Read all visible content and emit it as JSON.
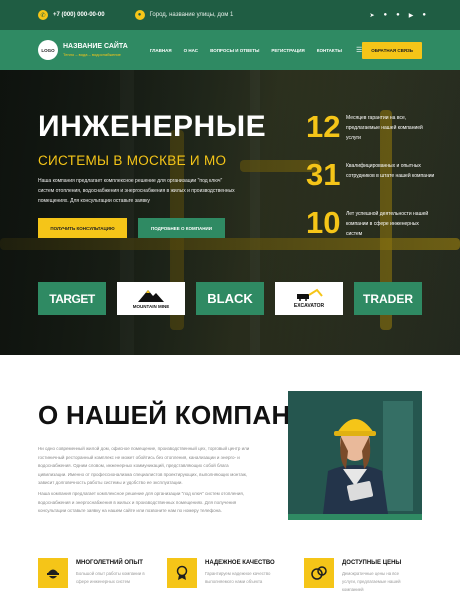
{
  "topbar": {
    "phone": "+7 (000) 000-00-00",
    "address": "Город, название улицы, дом 1",
    "phone_icon": "phone-icon",
    "address_icon": "location-pin-icon",
    "socials": [
      "telegram-icon",
      "vk-icon",
      "twitter-icon",
      "youtube-icon",
      "whatsapp-icon"
    ]
  },
  "header": {
    "logo": "LOGO",
    "brand_name": "НАЗВАНИЕ САЙТА",
    "tagline": "Тепло – вода – водоснабжение",
    "menu": [
      "ГЛАВНАЯ",
      "О НАС",
      "ВОПРОСЫ И ОТВЕТЫ",
      "РЕГИСТРАЦИЯ",
      "КОНТАКТЫ"
    ],
    "cta": "ОБРАТНАЯ СВЯЗЬ"
  },
  "hero": {
    "title": "ИНЖЕНЕРНЫЕ",
    "subtitle": "СИСТЕМЫ В МОСКВЕ И МО",
    "description": "Наша компания предлагает комплексное решение для организации \"под ключ\" систем отопления, водоснабжения и энергоснабжения в жилых и производственных помещениях. Для консультации оставьте заявку",
    "btn_consult": "ПОЛУЧИТЬ КОНСУЛЬТАЦИЮ",
    "btn_more": "ПОДРОБНЕЕ О КОМПАНИИ",
    "stats": [
      {
        "number": "12",
        "text": "Месяцев гарантии на все, предлагаемые нашей компанией услуги"
      },
      {
        "number": "31",
        "text": "Квалифицированных и опытных сотрудников в штате нашей компании"
      },
      {
        "number": "10",
        "text": "Лет успешной деятельности нашей компании в сфере инженерных систем"
      }
    ],
    "partners": [
      "TARGET",
      "MOUNTAIN MINE",
      "BLACK",
      "EXCAVATOR",
      "TRADER"
    ]
  },
  "about": {
    "title": "О НАШЕЙ КОМПАНИИ",
    "p1": "Ни одно современный жилой дом, офисное помещение, производственный цех, торговый центр или гостиничный ресторанный комплекс не может обойтись без отопления, канализации и энерго- и водоснабжения. Одним словом, инженерных коммуникаций, представляющих собой блага цивилизации. Именно от профессионализма специалистов проектирующих, выполняющих монтаж, зависит долговечность работы системы и удобство ее эксплуатации.",
    "p2": "Наша компания предлагает комплексное решение для организации \"под ключ\" систем отопления, водоснабжения и энергоснабжения в жилых и производственных помещениях. Для получения консультации оставьте заявку на нашем сайте или позвоните нам по номеру телефона."
  },
  "features": [
    {
      "title": "МНОГОЛЕТНИЙ ОПЫТ",
      "desc": "Большой опыт работы компании в сфере инженерных систем",
      "icon": "engineer-icon"
    },
    {
      "title": "НАДЕЖНОЕ КАЧЕСТВО",
      "desc": "Гарантируем надежное качество выполняемого нами объекта",
      "icon": "award-icon"
    },
    {
      "title": "ДОСТУПНЫЕ ЦЕНЫ",
      "desc": "Демократичные цены на все услуги, предлагаемые нашей компанией",
      "icon": "coins-icon"
    }
  ],
  "colors": {
    "primary_green": "#2f8a63",
    "dark_green": "#1f5d43",
    "accent_yellow": "#f5c518"
  }
}
